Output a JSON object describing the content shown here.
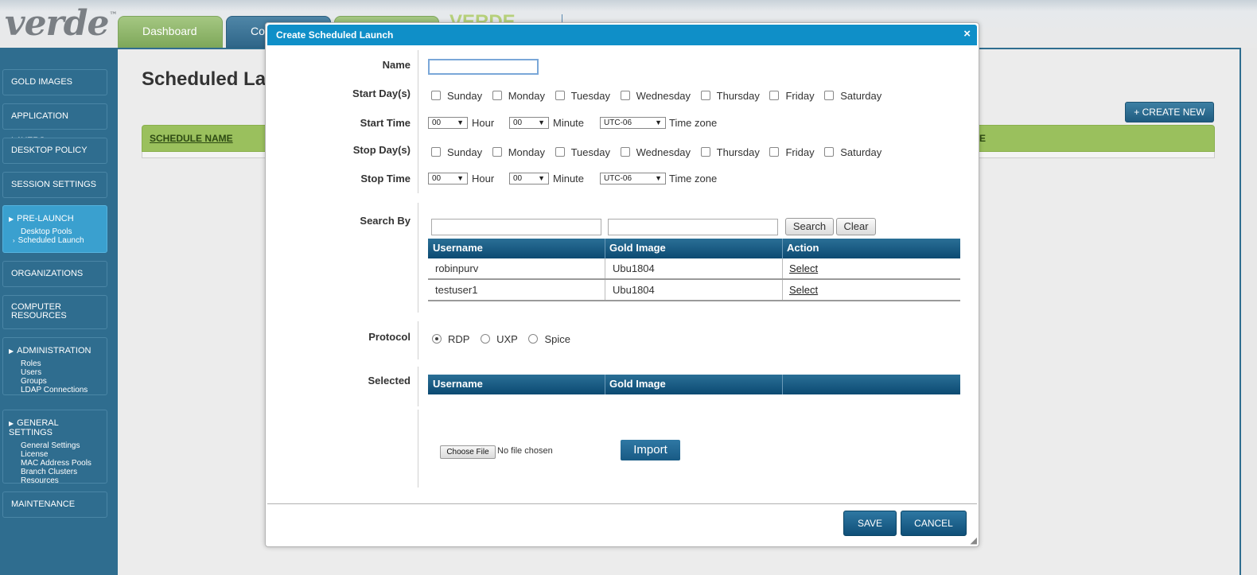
{
  "app": {
    "logo": "verde",
    "trademark": "™",
    "brand_right": "VERDE"
  },
  "top_tabs": [
    {
      "label": "Dashboard"
    },
    {
      "label": "Con"
    },
    {
      "label": ""
    }
  ],
  "sidebar": {
    "items": [
      {
        "label": "GOLD IMAGES"
      },
      {
        "label": "APPLICATION LAYERS"
      },
      {
        "label": "DESKTOP POLICY"
      },
      {
        "label": "SESSION SETTINGS"
      },
      {
        "label": "PRE-LAUNCH",
        "subitems": [
          "Desktop Pools",
          "Scheduled Launch"
        ]
      },
      {
        "label": "ORGANIZATIONS"
      },
      {
        "label": "COMPUTER RESOURCES"
      },
      {
        "label": "ADMINISTRATION",
        "subitems": [
          "Roles",
          "Users",
          "Groups",
          "LDAP Connections"
        ]
      },
      {
        "label": "GENERAL SETTINGS",
        "subitems": [
          "General Settings",
          "License",
          "MAC Address Pools",
          "Branch Clusters",
          "Resources"
        ]
      },
      {
        "label": "MAINTENANCE"
      }
    ]
  },
  "main": {
    "page_title": "Scheduled La",
    "create_new_label": "+ CREATE NEW",
    "list_columns": [
      "SCHEDULE NAME",
      "ME"
    ]
  },
  "modal": {
    "title": "Create Scheduled Launch",
    "close_icon": "×",
    "labels": {
      "name": "Name",
      "start_days": "Start Day(s)",
      "start_time": "Start Time",
      "stop_days": "Stop Day(s)",
      "stop_time": "Stop Time",
      "search_by": "Search By",
      "protocol": "Protocol",
      "selected": "Selected"
    },
    "name_value": "",
    "days": [
      "Sunday",
      "Monday",
      "Tuesday",
      "Wednesday",
      "Thursday",
      "Friday",
      "Saturday"
    ],
    "start_time": {
      "hour": "00",
      "hour_unit": "Hour",
      "minute": "00",
      "minute_unit": "Minute",
      "timezone": "UTC-06",
      "timezone_unit": "Time zone"
    },
    "stop_time": {
      "hour": "00",
      "hour_unit": "Hour",
      "minute": "00",
      "minute_unit": "Minute",
      "timezone": "UTC-06",
      "timezone_unit": "Time zone"
    },
    "search": {
      "field1_value": "",
      "field2_value": "",
      "search_label": "Search",
      "clear_label": "Clear"
    },
    "results_table": {
      "columns": [
        "Username",
        "Gold Image",
        "Action"
      ],
      "rows": [
        {
          "username": "robinpurv",
          "gold_image": "Ubu1804",
          "action": "Select"
        },
        {
          "username": "testuser1",
          "gold_image": "Ubu1804",
          "action": "Select"
        }
      ]
    },
    "protocol": {
      "options": [
        "RDP",
        "UXP",
        "Spice"
      ],
      "selected": "RDP"
    },
    "selected_table": {
      "columns": [
        "Username",
        "Gold Image",
        ""
      ]
    },
    "file": {
      "choose_label": "Choose File",
      "status": "No file chosen",
      "import_label": "Import"
    },
    "footer": {
      "save_label": "SAVE",
      "cancel_label": "CANCEL"
    }
  }
}
